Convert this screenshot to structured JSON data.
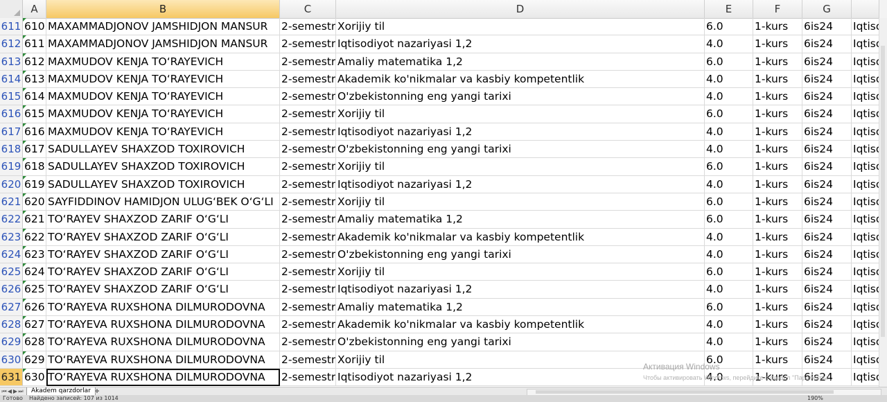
{
  "columns": [
    "A",
    "B",
    "C",
    "D",
    "E",
    "F",
    "G"
  ],
  "rows": [
    {
      "rn": "611",
      "a": "610",
      "b": "MAXAMMADJONOV JAMSHIDJON MANSUR",
      "c": "2-semestr",
      "d": "Xorijiy til",
      "e": "6.0",
      "f": "1-kurs",
      "g": "6is24",
      "h": "Iqtiso"
    },
    {
      "rn": "612",
      "a": "611",
      "b": "MAXAMMADJONOV JAMSHIDJON MANSUR",
      "c": "2-semestr",
      "d": "Iqtisodiyot nazariyasi 1,2",
      "e": "4.0",
      "f": "1-kurs",
      "g": "6is24",
      "h": "Iqtiso"
    },
    {
      "rn": "613",
      "a": "612",
      "b": "MAXMUDOV KENJA TO‘RAYEVICH",
      "c": "2-semestr",
      "d": "Amaliy matematika 1,2",
      "e": "6.0",
      "f": "1-kurs",
      "g": "6is24",
      "h": "Iqtiso"
    },
    {
      "rn": "614",
      "a": "613",
      "b": "MAXMUDOV KENJA TO‘RAYEVICH",
      "c": "2-semestr",
      "d": "Akademik ko'nikmalar va kasbiy kompetentlik",
      "e": "4.0",
      "f": "1-kurs",
      "g": "6is24",
      "h": "Iqtiso"
    },
    {
      "rn": "615",
      "a": "614",
      "b": "MAXMUDOV KENJA TO‘RAYEVICH",
      "c": "2-semestr",
      "d": "O'zbekistonning eng yangi tarixi",
      "e": "4.0",
      "f": "1-kurs",
      "g": "6is24",
      "h": "Iqtiso"
    },
    {
      "rn": "616",
      "a": "615",
      "b": "MAXMUDOV KENJA TO‘RAYEVICH",
      "c": "2-semestr",
      "d": "Xorijiy til",
      "e": "6.0",
      "f": "1-kurs",
      "g": "6is24",
      "h": "Iqtiso"
    },
    {
      "rn": "617",
      "a": "616",
      "b": "MAXMUDOV KENJA TO‘RAYEVICH",
      "c": "2-semestr",
      "d": "Iqtisodiyot nazariyasi 1,2",
      "e": "4.0",
      "f": "1-kurs",
      "g": "6is24",
      "h": "Iqtiso"
    },
    {
      "rn": "618",
      "a": "617",
      "b": "SADULLAYEV SHAXZOD TOXIROVICH",
      "c": "2-semestr",
      "d": "O'zbekistonning eng yangi tarixi",
      "e": "4.0",
      "f": "1-kurs",
      "g": "6is24",
      "h": "Iqtiso"
    },
    {
      "rn": "619",
      "a": "618",
      "b": "SADULLAYEV SHAXZOD TOXIROVICH",
      "c": "2-semestr",
      "d": "Xorijiy til",
      "e": "6.0",
      "f": "1-kurs",
      "g": "6is24",
      "h": "Iqtiso"
    },
    {
      "rn": "620",
      "a": "619",
      "b": "SADULLAYEV SHAXZOD TOXIROVICH",
      "c": "2-semestr",
      "d": "Iqtisodiyot nazariyasi 1,2",
      "e": "4.0",
      "f": "1-kurs",
      "g": "6is24",
      "h": "Iqtiso"
    },
    {
      "rn": "621",
      "a": "620",
      "b": "SAYFIDDINOV HAMIDJON ULUG‘BEK O‘G‘LI",
      "c": "2-semestr",
      "d": "Xorijiy til",
      "e": "6.0",
      "f": "1-kurs",
      "g": "6is24",
      "h": "Iqtiso"
    },
    {
      "rn": "622",
      "a": "621",
      "b": "TO‘RAYEV SHAXZOD ZARIF O‘G‘LI",
      "c": "2-semestr",
      "d": "Amaliy matematika 1,2",
      "e": "6.0",
      "f": "1-kurs",
      "g": "6is24",
      "h": "Iqtiso"
    },
    {
      "rn": "623",
      "a": "622",
      "b": "TO‘RAYEV SHAXZOD ZARIF O‘G‘LI",
      "c": "2-semestr",
      "d": "Akademik ko'nikmalar va kasbiy kompetentlik",
      "e": "4.0",
      "f": "1-kurs",
      "g": "6is24",
      "h": "Iqtiso"
    },
    {
      "rn": "624",
      "a": "623",
      "b": "TO‘RAYEV SHAXZOD ZARIF O‘G‘LI",
      "c": "2-semestr",
      "d": "O'zbekistonning eng yangi tarixi",
      "e": "4.0",
      "f": "1-kurs",
      "g": "6is24",
      "h": "Iqtiso"
    },
    {
      "rn": "625",
      "a": "624",
      "b": "TO‘RAYEV SHAXZOD ZARIF O‘G‘LI",
      "c": "2-semestr",
      "d": "Xorijiy til",
      "e": "6.0",
      "f": "1-kurs",
      "g": "6is24",
      "h": "Iqtiso"
    },
    {
      "rn": "626",
      "a": "625",
      "b": "TO‘RAYEV SHAXZOD ZARIF O‘G‘LI",
      "c": "2-semestr",
      "d": "Iqtisodiyot nazariyasi 1,2",
      "e": "4.0",
      "f": "1-kurs",
      "g": "6is24",
      "h": "Iqtiso"
    },
    {
      "rn": "627",
      "a": "626",
      "b": "TO‘RAYEVA RUXSHONA DILMURODOVNA",
      "c": "2-semestr",
      "d": "Amaliy matematika 1,2",
      "e": "6.0",
      "f": "1-kurs",
      "g": "6is24",
      "h": "Iqtiso"
    },
    {
      "rn": "628",
      "a": "627",
      "b": "TO‘RAYEVA RUXSHONA DILMURODOVNA",
      "c": "2-semestr",
      "d": "Akademik ko'nikmalar va kasbiy kompetentlik",
      "e": "4.0",
      "f": "1-kurs",
      "g": "6is24",
      "h": "Iqtiso"
    },
    {
      "rn": "629",
      "a": "628",
      "b": "TO‘RAYEVA RUXSHONA DILMURODOVNA",
      "c": "2-semestr",
      "d": "O'zbekistonning eng yangi tarixi",
      "e": "4.0",
      "f": "1-kurs",
      "g": "6is24",
      "h": "Iqtiso"
    },
    {
      "rn": "630",
      "a": "629",
      "b": "TO‘RAYEVA RUXSHONA DILMURODOVNA",
      "c": "2-semestr",
      "d": "Xorijiy til",
      "e": "6.0",
      "f": "1-kurs",
      "g": "6is24",
      "h": "Iqtiso"
    },
    {
      "rn": "631",
      "a": "630",
      "b": "TO‘RAYEVA RUXSHONA DILMURODOVNA",
      "c": "2-semestr",
      "d": "Iqtisodiyot nazariyasi 1,2",
      "e": "4.0",
      "f": "1-kurs",
      "g": "6is24",
      "h": "Iqtiso"
    }
  ],
  "active_row": "631",
  "selected_column": "B",
  "sheet_tab": "Akadem qarzdorlar",
  "status": {
    "ready": "Готово",
    "found": "Найдено записей: 107 из 1014",
    "zoom": "190%"
  },
  "watermark": {
    "title": "Активация Windows",
    "subtitle": "Чтобы активировать Windows, перейдите в раздел \"Параметры\"."
  },
  "colors": {
    "row_number_text": "#2b52b8",
    "active_header": "#f6c864"
  }
}
